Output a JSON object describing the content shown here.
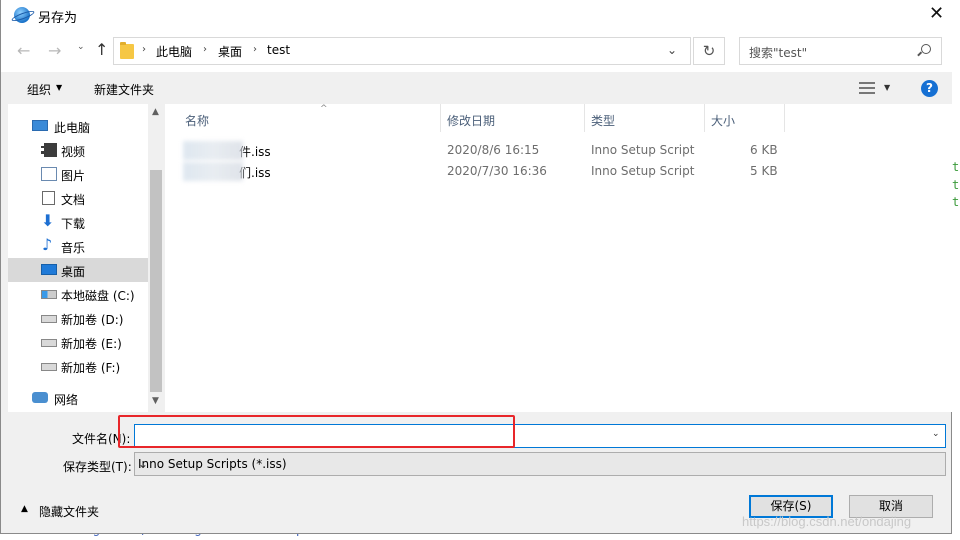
{
  "window": {
    "title": "另存为",
    "close_glyph": "✕"
  },
  "nav": {
    "back_glyph": "←",
    "forward_glyph": "→",
    "recent_glyph": "⌄",
    "up_glyph": "↑",
    "breadcrumb": [
      "此电脑",
      "桌面",
      "test"
    ],
    "crumb_separator": "›",
    "refresh_glyph": "↻",
    "search_placeholder": "搜索\"test\""
  },
  "toolbar": {
    "organize_label": "组织",
    "organize_caret": "▼",
    "new_folder_label": "新建文件夹",
    "view_caret": "▼",
    "help_label": "?"
  },
  "sidebar": {
    "items": [
      {
        "label": "此电脑",
        "icon": "computer-icon"
      },
      {
        "label": "视频",
        "icon": "video-icon"
      },
      {
        "label": "图片",
        "icon": "picture-icon"
      },
      {
        "label": "文档",
        "icon": "document-icon"
      },
      {
        "label": "下载",
        "icon": "download-icon"
      },
      {
        "label": "音乐",
        "icon": "music-icon"
      },
      {
        "label": "桌面",
        "icon": "desktop-icon",
        "selected": true
      },
      {
        "label": "本地磁盘 (C:)",
        "icon": "system-drive-icon"
      },
      {
        "label": "新加卷 (D:)",
        "icon": "drive-icon"
      },
      {
        "label": "新加卷 (E:)",
        "icon": "drive-icon"
      },
      {
        "label": "新加卷 (F:)",
        "icon": "drive-icon"
      },
      {
        "label": "网络",
        "icon": "network-icon"
      }
    ],
    "scroll_up_glyph": "▲",
    "scroll_down_glyph": "▼"
  },
  "file_list": {
    "columns": [
      "名称",
      "修改日期",
      "类型",
      "大小"
    ],
    "sort_glyph": "^",
    "rows": [
      {
        "name": "件.iss",
        "date": "2020/8/6 16:15",
        "type": "Inno Setup Script",
        "size": "6 KB"
      },
      {
        "name": "们.iss",
        "date": "2020/7/30 16:36",
        "type": "Inno Setup Script",
        "size": "5 KB"
      }
    ]
  },
  "form": {
    "filename_label": "文件名(N):",
    "filename_value": "",
    "filetype_label": "保存类型(T):",
    "filetype_value": "Inno Setup Scripts (*.iss)",
    "dropdown_glyph": "⌄"
  },
  "footer": {
    "hide_folders_label": "隐藏文件夹",
    "hide_caret": "▲",
    "save_label": "保存(S)",
    "cancel_label": "取消"
  },
  "background": {
    "code_line": "Name: \"english\"; MessagesFile: \"compiler:Default.isl\"",
    "right_glyph_a": "t",
    "right_glyph_b": "t",
    "right_glyph_c": "t",
    "watermark": "https://blog.csdn.net/ondajing"
  },
  "colors": {
    "accent": "#0078d7",
    "highlight_box": "#e8262a",
    "selected_bg": "#d9d9d9",
    "help_blue": "#1670d3"
  }
}
